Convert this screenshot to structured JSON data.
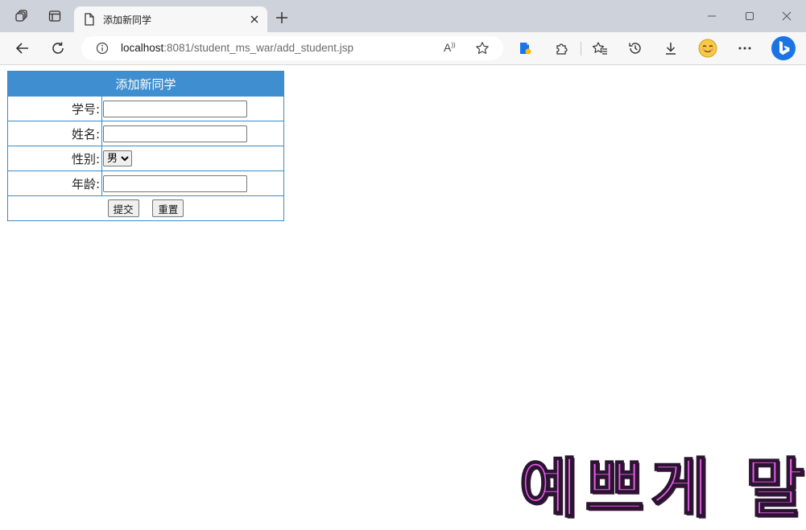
{
  "browser": {
    "tab": {
      "title": "添加新同学"
    },
    "address": {
      "host": "localhost",
      "path": ":8081/student_ms_war/add_student.jsp"
    },
    "icons": {
      "workspaces": "workspaces-icon",
      "tab_actions": "tab-actions-icon",
      "page": "page-icon",
      "close": "close-icon",
      "new_tab": "plus-icon",
      "minimize": "minimize-icon",
      "maximize": "maximize-icon",
      "close_window": "close-window-icon",
      "back": "back-arrow-icon",
      "refresh": "refresh-icon",
      "info": "info-icon",
      "read_aloud": "read-aloud-icon",
      "favorite": "star-icon",
      "extension1": "file-extension-icon",
      "extensions": "puzzle-icon",
      "favorites": "favorites-icon",
      "history": "history-icon",
      "downloads": "download-icon",
      "profile": "profile-emoji-icon",
      "more": "more-icon",
      "bing": "bing-icon"
    },
    "read_aloud_label": "A"
  },
  "form": {
    "caption": "添加新同学",
    "rows": {
      "student_id": {
        "label": "学号:",
        "value": ""
      },
      "name": {
        "label": "姓名:",
        "value": ""
      },
      "gender": {
        "label": "性别:",
        "selected": "男"
      },
      "age": {
        "label": "年龄:",
        "value": ""
      }
    },
    "submit_label": "提交",
    "reset_label": "重置"
  },
  "overlay": {
    "text": "예쁘게 말"
  },
  "colors": {
    "accent": "#3f8fd0",
    "border": "#3b8ac9",
    "overlay": "#e75de8"
  }
}
